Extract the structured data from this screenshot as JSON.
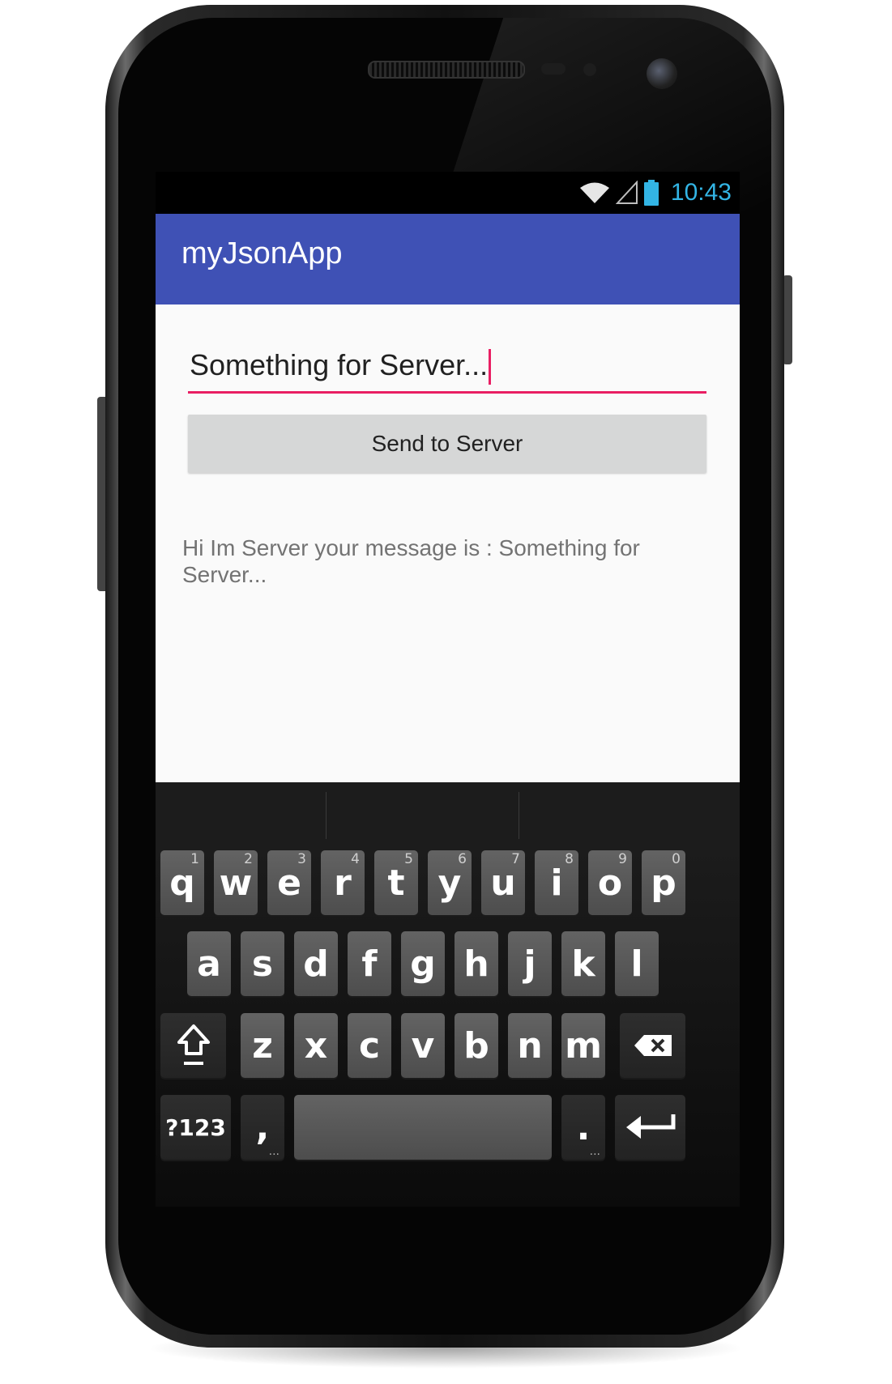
{
  "status_bar": {
    "time": "10:43",
    "icons": [
      "wifi-icon",
      "signal-icon",
      "battery-icon"
    ]
  },
  "app": {
    "title": "myJsonApp",
    "accent": "#3f51b5",
    "cursor_color": "#e91e63"
  },
  "form": {
    "input_value": "Something for Server...",
    "send_label": "Send to Server",
    "response_text": "Hi Im Server your message is : Something for Server..."
  },
  "keyboard": {
    "row1": [
      {
        "key": "q",
        "hint": "1"
      },
      {
        "key": "w",
        "hint": "2"
      },
      {
        "key": "e",
        "hint": "3"
      },
      {
        "key": "r",
        "hint": "4"
      },
      {
        "key": "t",
        "hint": "5"
      },
      {
        "key": "y",
        "hint": "6"
      },
      {
        "key": "u",
        "hint": "7"
      },
      {
        "key": "i",
        "hint": "8"
      },
      {
        "key": "o",
        "hint": "9"
      },
      {
        "key": "p",
        "hint": "0"
      }
    ],
    "row2": [
      "a",
      "s",
      "d",
      "f",
      "g",
      "h",
      "j",
      "k",
      "l"
    ],
    "row3": [
      "z",
      "x",
      "c",
      "v",
      "b",
      "n",
      "m"
    ],
    "symbols_label": "?123",
    "comma": ",",
    "period": ".",
    "more_hint": "..."
  }
}
